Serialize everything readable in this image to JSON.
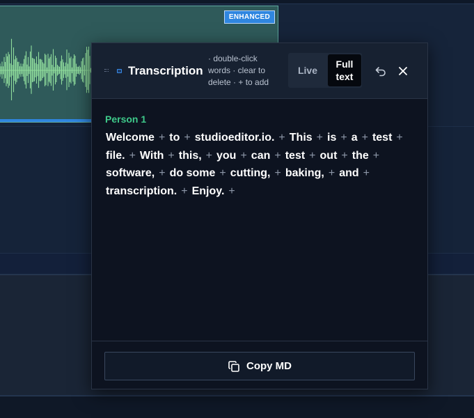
{
  "clip": {
    "badge": "ENHANCED",
    "waveform_color": "#8fdc9c"
  },
  "panel": {
    "title": "Transcription",
    "hint": "· double-click words · clear to delete · + to add",
    "modes": {
      "live": "Live",
      "full_text": "Full text",
      "active": "full_text"
    },
    "icons": {
      "drag": "drag-handle-icon",
      "speaker_color": "blue-square-icon",
      "undo": "undo-icon",
      "close": "close-icon",
      "copy": "copy-icon"
    },
    "speaker": {
      "name": "Person 1",
      "color": "#3ec98a"
    },
    "words": [
      "Welcome",
      "to",
      "studioeditor.io.",
      "This",
      "is",
      "a",
      "test",
      "file.",
      "With",
      "this,",
      "you",
      "can",
      "test",
      "out",
      "the",
      "software,",
      "do",
      "some",
      "cutting,",
      "baking,",
      "and",
      "transcription.",
      "Enjoy."
    ],
    "word_plus_before": [
      false,
      true,
      true,
      true,
      true,
      true,
      true,
      true,
      true,
      true,
      true,
      true,
      true,
      true,
      true,
      true,
      true,
      false,
      true,
      true,
      true,
      true,
      true
    ],
    "add_symbol": "+",
    "copy_button": "Copy MD"
  },
  "colors": {
    "accent_blue": "#2f86e0",
    "panel_bg": "#0d1320",
    "header_bg": "#172131"
  }
}
